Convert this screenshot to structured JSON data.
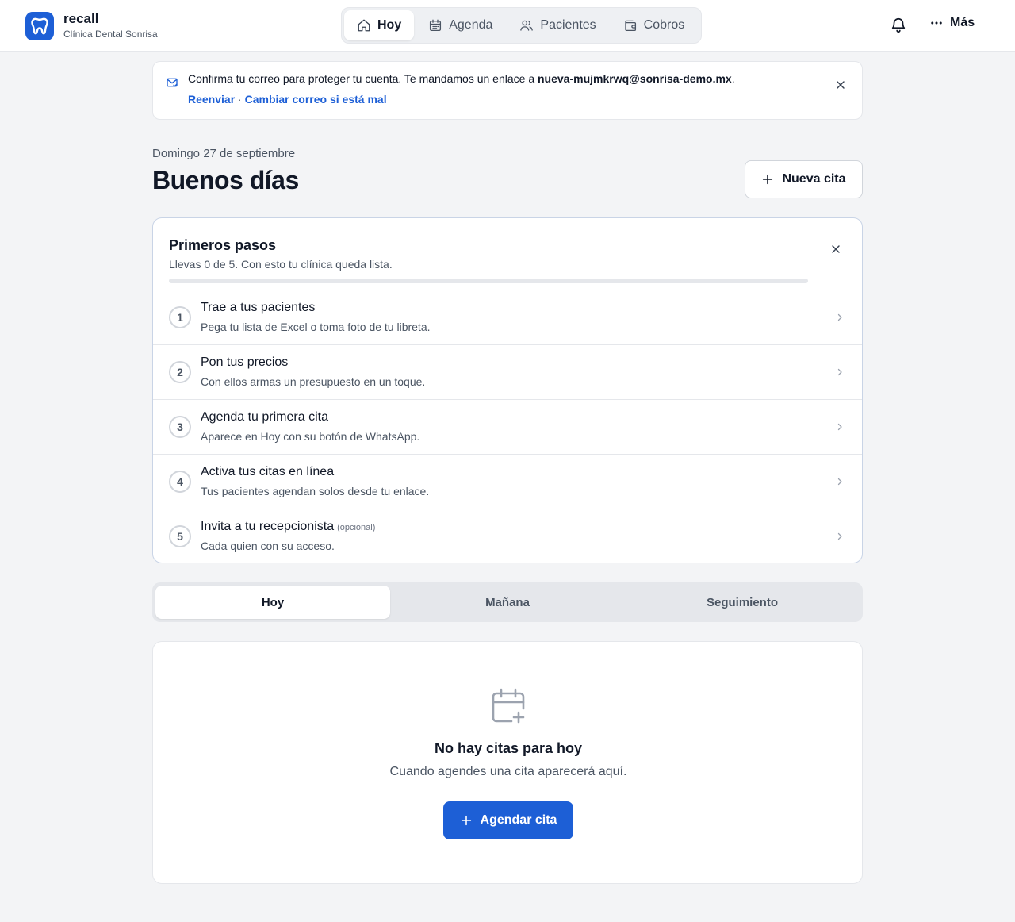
{
  "brand": {
    "name": "recall",
    "clinic": "Clínica Dental Sonrisa",
    "color": "#1d5fd6"
  },
  "nav": {
    "items": [
      {
        "label": "Hoy",
        "icon": "home-icon",
        "active": true
      },
      {
        "label": "Agenda",
        "icon": "calendar-icon",
        "active": false
      },
      {
        "label": "Pacientes",
        "icon": "users-icon",
        "active": false
      },
      {
        "label": "Cobros",
        "icon": "wallet-icon",
        "active": false
      }
    ],
    "more_label": "Más"
  },
  "notice": {
    "text_before": "Confirma tu correo para proteger tu cuenta. Te mandamos un enlace a ",
    "email": "nueva-mujmkrwq@sonrisa-demo.mx",
    "text_after": ".",
    "resend_label": "Reenviar",
    "separator": " · ",
    "change_label": "Cambiar correo si está mal"
  },
  "header": {
    "date": "Domingo 27 de septiembre",
    "greeting": "Buenos días",
    "new_appointment_label": "Nueva cita"
  },
  "onboarding": {
    "title": "Primeros pasos",
    "subtitle": "Llevas 0 de 5. Con esto tu clínica queda lista.",
    "progress": 0,
    "steps": [
      {
        "number": "1",
        "title": "Trae a tus pacientes",
        "optional": "",
        "description": "Pega tu lista de Excel o toma foto de tu libreta."
      },
      {
        "number": "2",
        "title": "Pon tus precios",
        "optional": "",
        "description": "Con ellos armas un presupuesto en un toque."
      },
      {
        "number": "3",
        "title": "Agenda tu primera cita",
        "optional": "",
        "description": "Aparece en Hoy con su botón de WhatsApp."
      },
      {
        "number": "4",
        "title": "Activa tus citas en línea",
        "optional": "",
        "description": "Tus pacientes agendan solos desde tu enlace."
      },
      {
        "number": "5",
        "title": "Invita a tu recepcionista",
        "optional": "(opcional)",
        "description": "Cada quien con su acceso."
      }
    ]
  },
  "tabs": [
    {
      "label": "Hoy",
      "active": true
    },
    {
      "label": "Mañana",
      "active": false
    },
    {
      "label": "Seguimiento",
      "active": false
    }
  ],
  "empty_state": {
    "icon": "calendar-plus-icon",
    "title": "No hay citas para hoy",
    "subtitle": "Cuando agendes una cita aparecerá aquí.",
    "button_label": "Agendar cita"
  }
}
